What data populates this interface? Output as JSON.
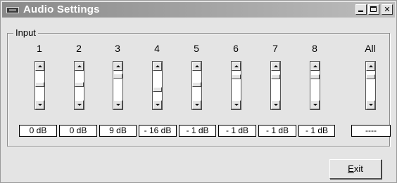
{
  "window": {
    "title": "Audio Settings",
    "icon": "window-app-icon"
  },
  "title_buttons": {
    "minimize": "minimize-icon",
    "maximize": "maximize-icon",
    "close": "✕"
  },
  "group": {
    "label": "Input"
  },
  "channels": [
    {
      "label": "1",
      "value": "0 dB",
      "level": 0.55
    },
    {
      "label": "2",
      "value": "0 dB",
      "level": 0.55
    },
    {
      "label": "3",
      "value": "9 dB",
      "level": 0.88
    },
    {
      "label": "4",
      "value": "- 16 dB",
      "level": 0.35
    },
    {
      "label": "5",
      "value": "- 1 dB",
      "level": 0.55
    },
    {
      "label": "6",
      "value": "- 1 dB",
      "level": 0.85
    },
    {
      "label": "7",
      "value": "- 1 dB",
      "level": 0.85
    },
    {
      "label": "8",
      "value": "- 1 dB",
      "level": 0.85
    }
  ],
  "all": {
    "label": "All",
    "value": "----",
    "level": 0.85
  },
  "footer": {
    "exit_label_prefix": "E",
    "exit_label_rest": "xit"
  }
}
